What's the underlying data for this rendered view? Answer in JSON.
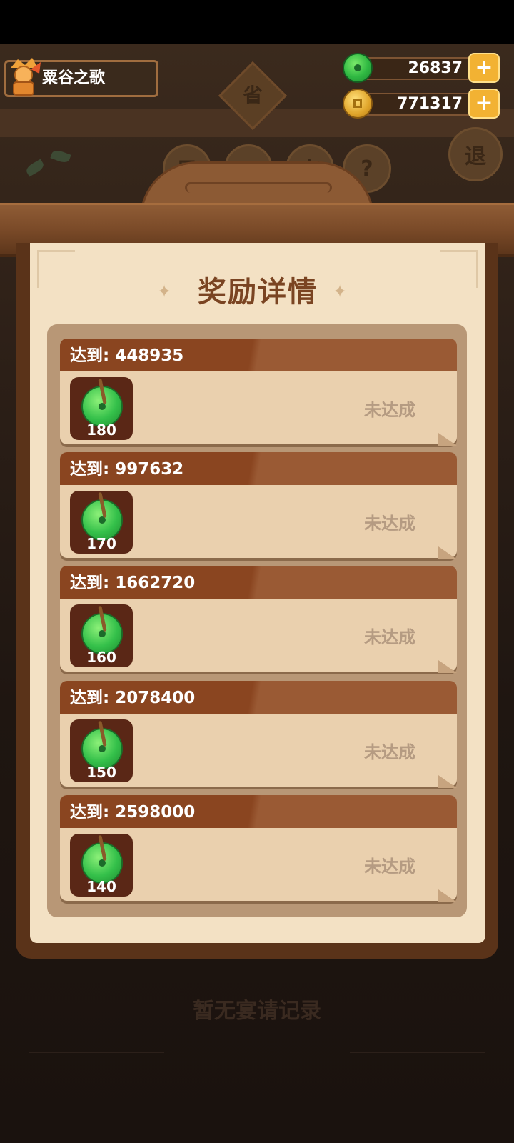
{
  "player": {
    "name": "粟谷之歌"
  },
  "currencies": {
    "jade": {
      "amount": "26837",
      "icon": "jade-icon"
    },
    "coin": {
      "amount": "771317",
      "icon": "coin-icon"
    }
  },
  "background": {
    "province_label": "省",
    "buttons": [
      "风",
      "二",
      "宴",
      "?",
      "退"
    ],
    "empty_text": "暂无宴请记录"
  },
  "panel": {
    "title": "奖励详情",
    "rewards": [
      {
        "label": "达到: 448935",
        "qty": "180",
        "status": "未达成"
      },
      {
        "label": "达到: 997632",
        "qty": "170",
        "status": "未达成"
      },
      {
        "label": "达到: 1662720",
        "qty": "160",
        "status": "未达成"
      },
      {
        "label": "达到: 2078400",
        "qty": "150",
        "status": "未达成"
      },
      {
        "label": "达到: 2598000",
        "qty": "140",
        "status": "未达成"
      }
    ]
  },
  "colors": {
    "accent": "#8a4520",
    "panel": "#f3e1c4",
    "plus": "#f2b233",
    "status": "#b59b82"
  }
}
